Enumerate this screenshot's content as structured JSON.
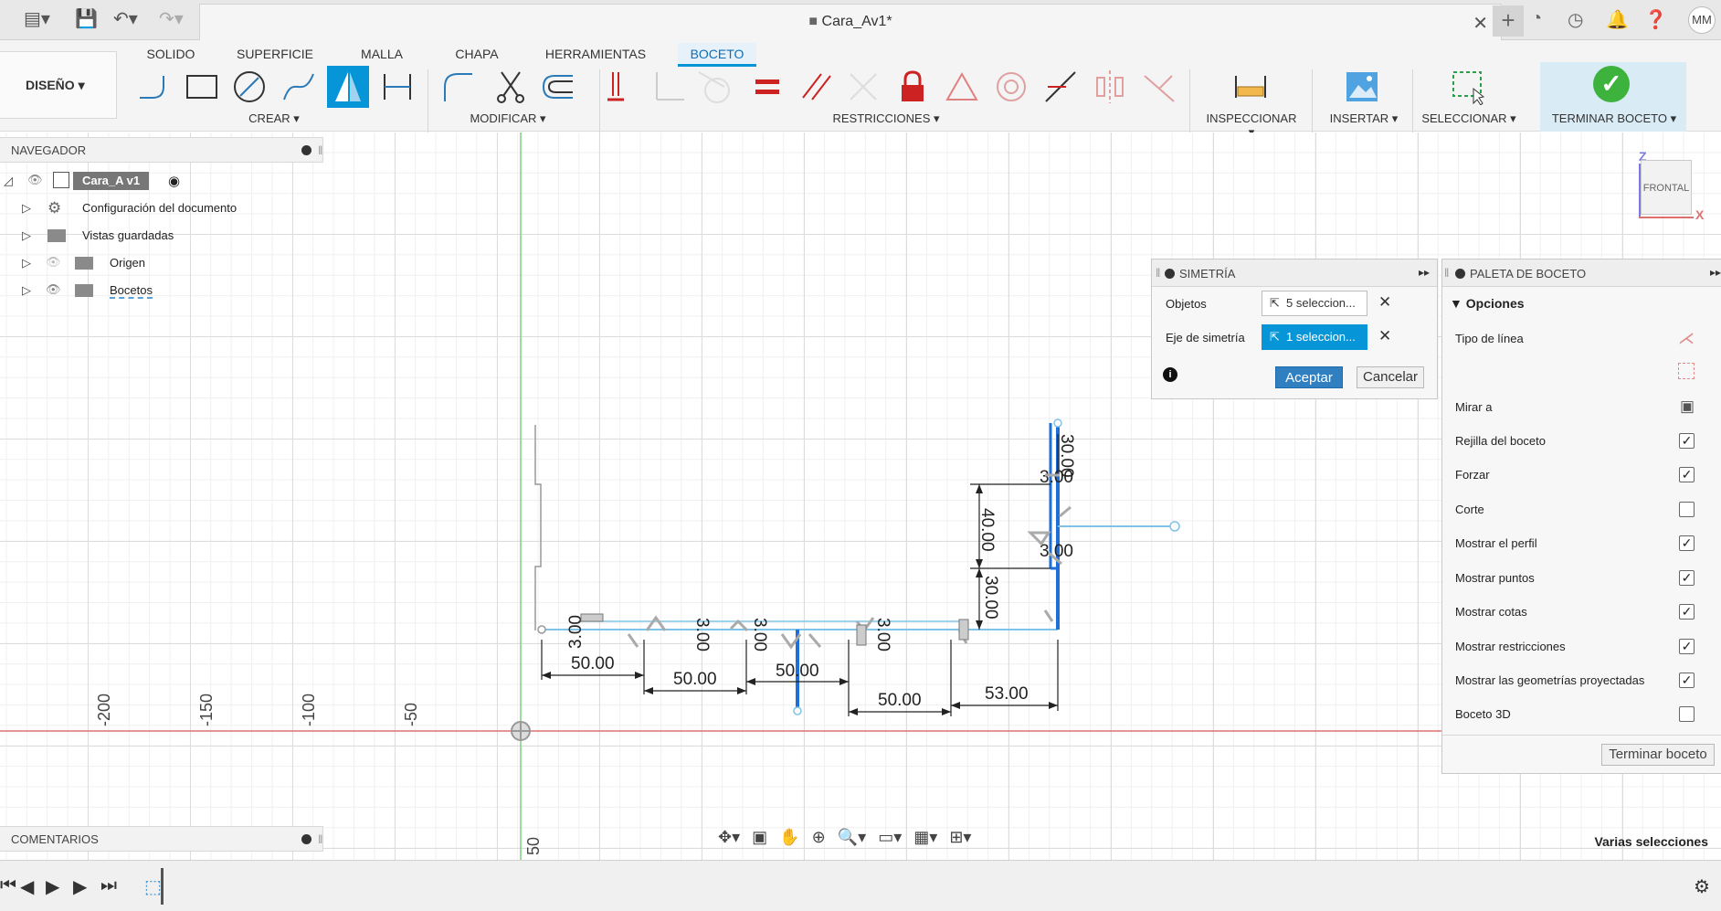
{
  "title_bar": {
    "doc_title": "Cara_Av1*",
    "avatar": "MM"
  },
  "ribbon": {
    "design_label": "DISEÑO ▾",
    "tabs": [
      "SOLIDO",
      "SUPERFICIE",
      "MALLA",
      "CHAPA",
      "HERRAMIENTAS",
      "BOCETO"
    ],
    "active_tab": "BOCETO",
    "groups": {
      "create": "CREAR ▾",
      "modify": "MODIFICAR ▾",
      "constraints": "RESTRICCIONES ▾",
      "inspect": "INSPECCIONAR ▾",
      "insert": "INSERTAR ▾",
      "select": "SELECCIONAR ▾",
      "finish": "TERMINAR BOCETO ▾"
    }
  },
  "navigator": {
    "header": "NAVEGADOR",
    "root": "Cara_A v1",
    "items": [
      "Configuración del documento",
      "Vistas guardadas",
      "Origen",
      "Bocetos"
    ]
  },
  "comments": {
    "header": "COMENTARIOS"
  },
  "viewcube": {
    "face": "FRONTAL",
    "axis_z": "Z",
    "axis_x": "X"
  },
  "mirror_dialog": {
    "header": "SIMETRÍA",
    "objects_label": "Objetos",
    "objects_value": "5 seleccion...",
    "axis_label": "Eje de simetría",
    "axis_value": "1 seleccion...",
    "ok": "Aceptar",
    "cancel": "Cancelar"
  },
  "sketch_palette": {
    "header": "PALETA DE BOCETO",
    "section": "Opciones",
    "line_type": "Tipo de línea",
    "look_at": "Mirar a",
    "options": [
      {
        "label": "Rejilla del boceto",
        "checked": true
      },
      {
        "label": "Forzar",
        "checked": true
      },
      {
        "label": "Corte",
        "checked": false
      },
      {
        "label": "Mostrar el perfil",
        "checked": true
      },
      {
        "label": "Mostrar puntos",
        "checked": true
      },
      {
        "label": "Mostrar cotas",
        "checked": true
      },
      {
        "label": "Mostrar restricciones",
        "checked": true
      },
      {
        "label": "Mostrar las geometrías proyectadas",
        "checked": true
      },
      {
        "label": "Boceto 3D",
        "checked": false
      }
    ],
    "finish_button": "Terminar boceto"
  },
  "canvas": {
    "ruler_labels": [
      "-200",
      "-150",
      "-100",
      "-50",
      "50"
    ],
    "dimensions": [
      "50.00",
      "50.00",
      "50.00",
      "50.00",
      "53.00",
      "40.00",
      "30.00",
      "30.00",
      "3.00",
      "3.00",
      "3.00",
      "3.00",
      "3.00",
      "3.00"
    ]
  },
  "status": {
    "selection": "Varias selecciones"
  },
  "colors": {
    "accent": "#0696d7",
    "sketch_line": "#7fc4e8",
    "selected_line": "#1e6fd9",
    "origin_red": "#e07070",
    "origin_green": "#7dd07d"
  }
}
